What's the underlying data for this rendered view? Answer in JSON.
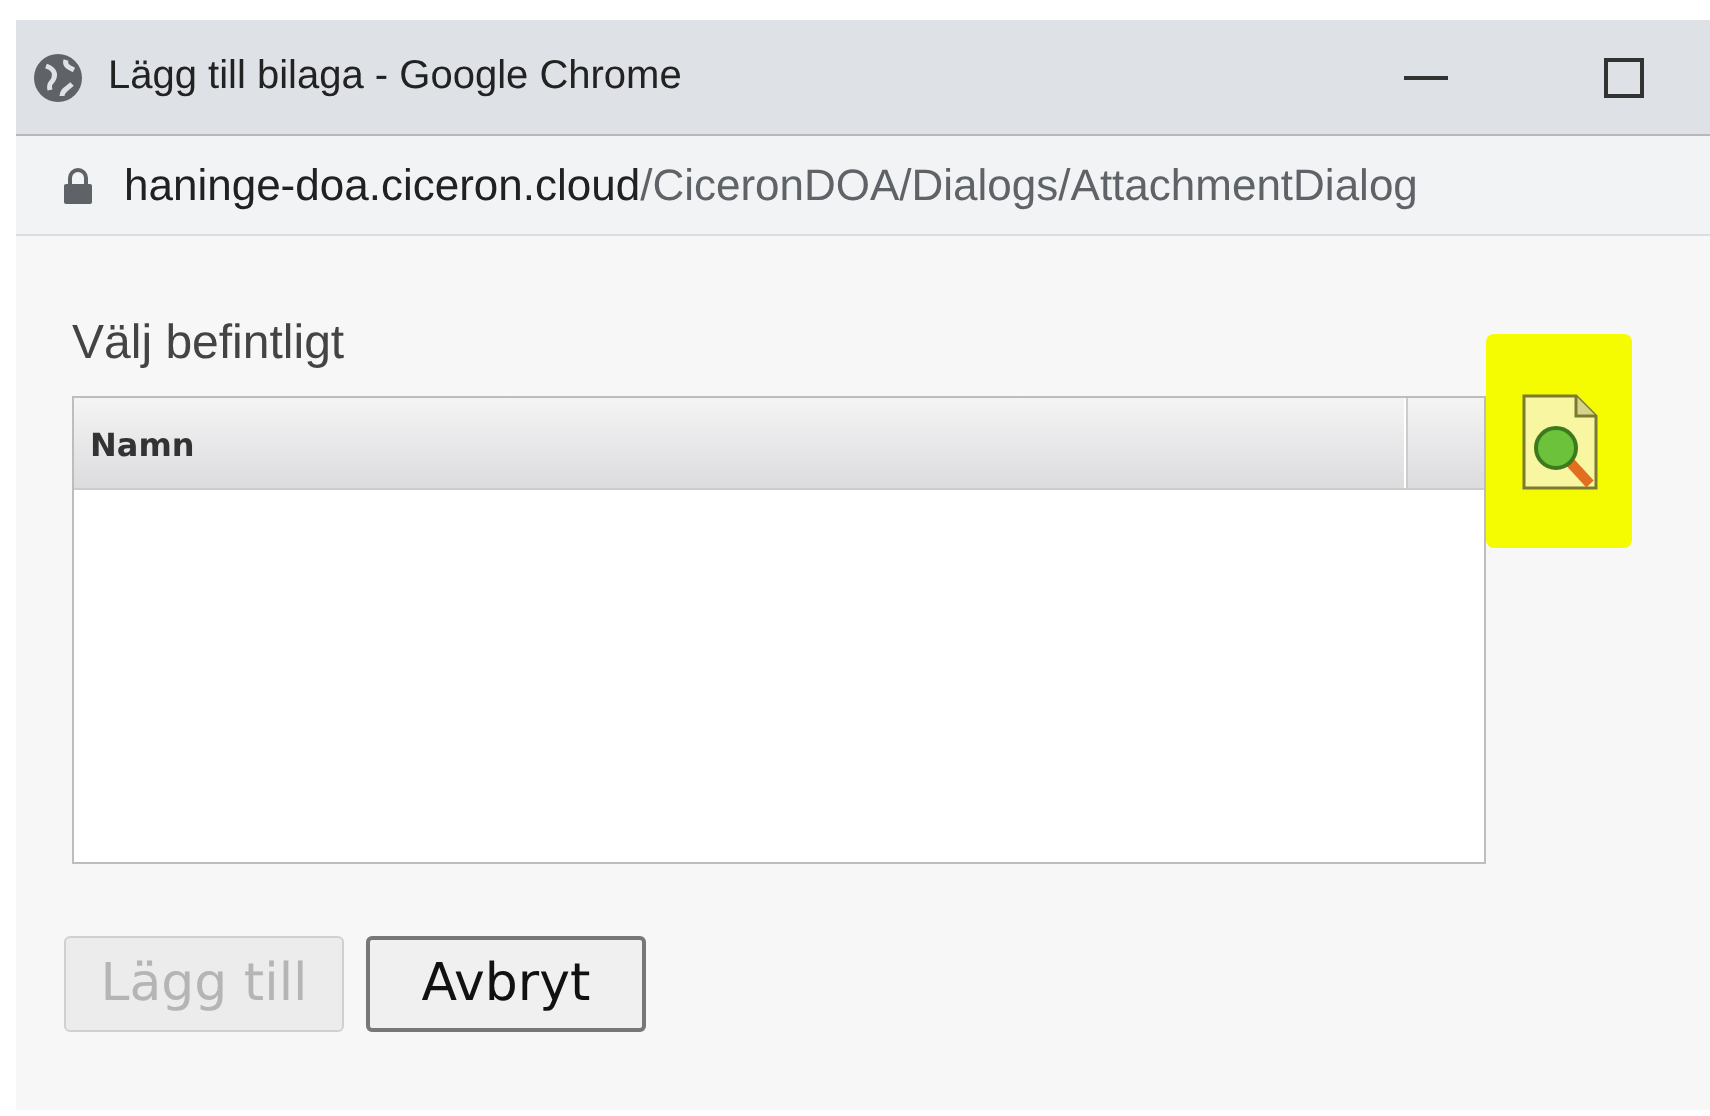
{
  "window": {
    "title": "Lägg till bilaga - Google Chrome"
  },
  "address_bar": {
    "host": "haninge-doa.ciceron.cloud",
    "path": "/CiceronDOA/Dialogs/AttachmentDialog"
  },
  "section_title": "Välj befintligt",
  "table": {
    "columns": [
      "Namn"
    ]
  },
  "buttons": [
    {
      "label": "Lägg till",
      "disabled": true
    },
    {
      "label": "Avbryt",
      "disabled": false
    }
  ]
}
